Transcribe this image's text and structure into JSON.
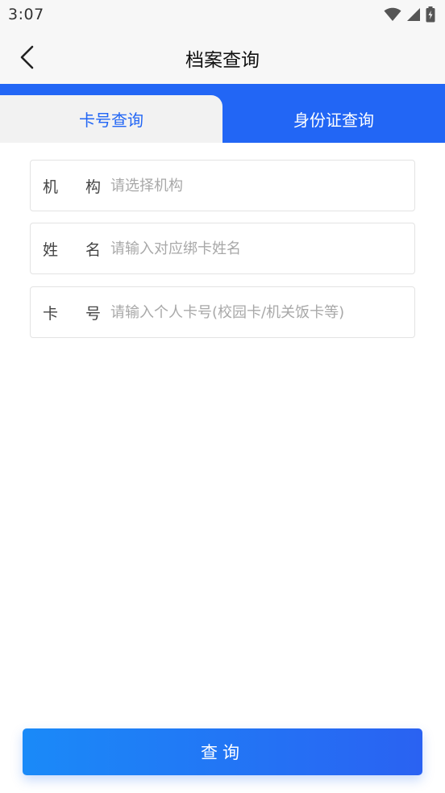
{
  "status_bar": {
    "time": "3:07",
    "icons": [
      "wifi-icon",
      "signal-icon",
      "battery-icon"
    ]
  },
  "header": {
    "title": "档案查询",
    "back_icon": "chevron-left-icon"
  },
  "tabs": [
    {
      "label": "卡号查询",
      "active": true
    },
    {
      "label": "身份证查询",
      "active": false
    }
  ],
  "form": {
    "institution": {
      "label_left": "机",
      "label_right": "构",
      "placeholder": "请选择机构",
      "value": ""
    },
    "name": {
      "label_left": "姓",
      "label_right": "名",
      "placeholder": "请输入对应绑卡姓名",
      "value": ""
    },
    "card_no": {
      "label_left": "卡",
      "label_right": "号",
      "placeholder": "请输入个人卡号(校园卡/机关饭卡等)",
      "value": ""
    }
  },
  "submit": {
    "label": "查询"
  },
  "colors": {
    "accent": "#2266f5",
    "tab_inactive_bg": "#f2f2f2",
    "placeholder": "#a8a8a8",
    "button_gradient_start": "#1a8af8",
    "button_gradient_end": "#2a62f2"
  }
}
